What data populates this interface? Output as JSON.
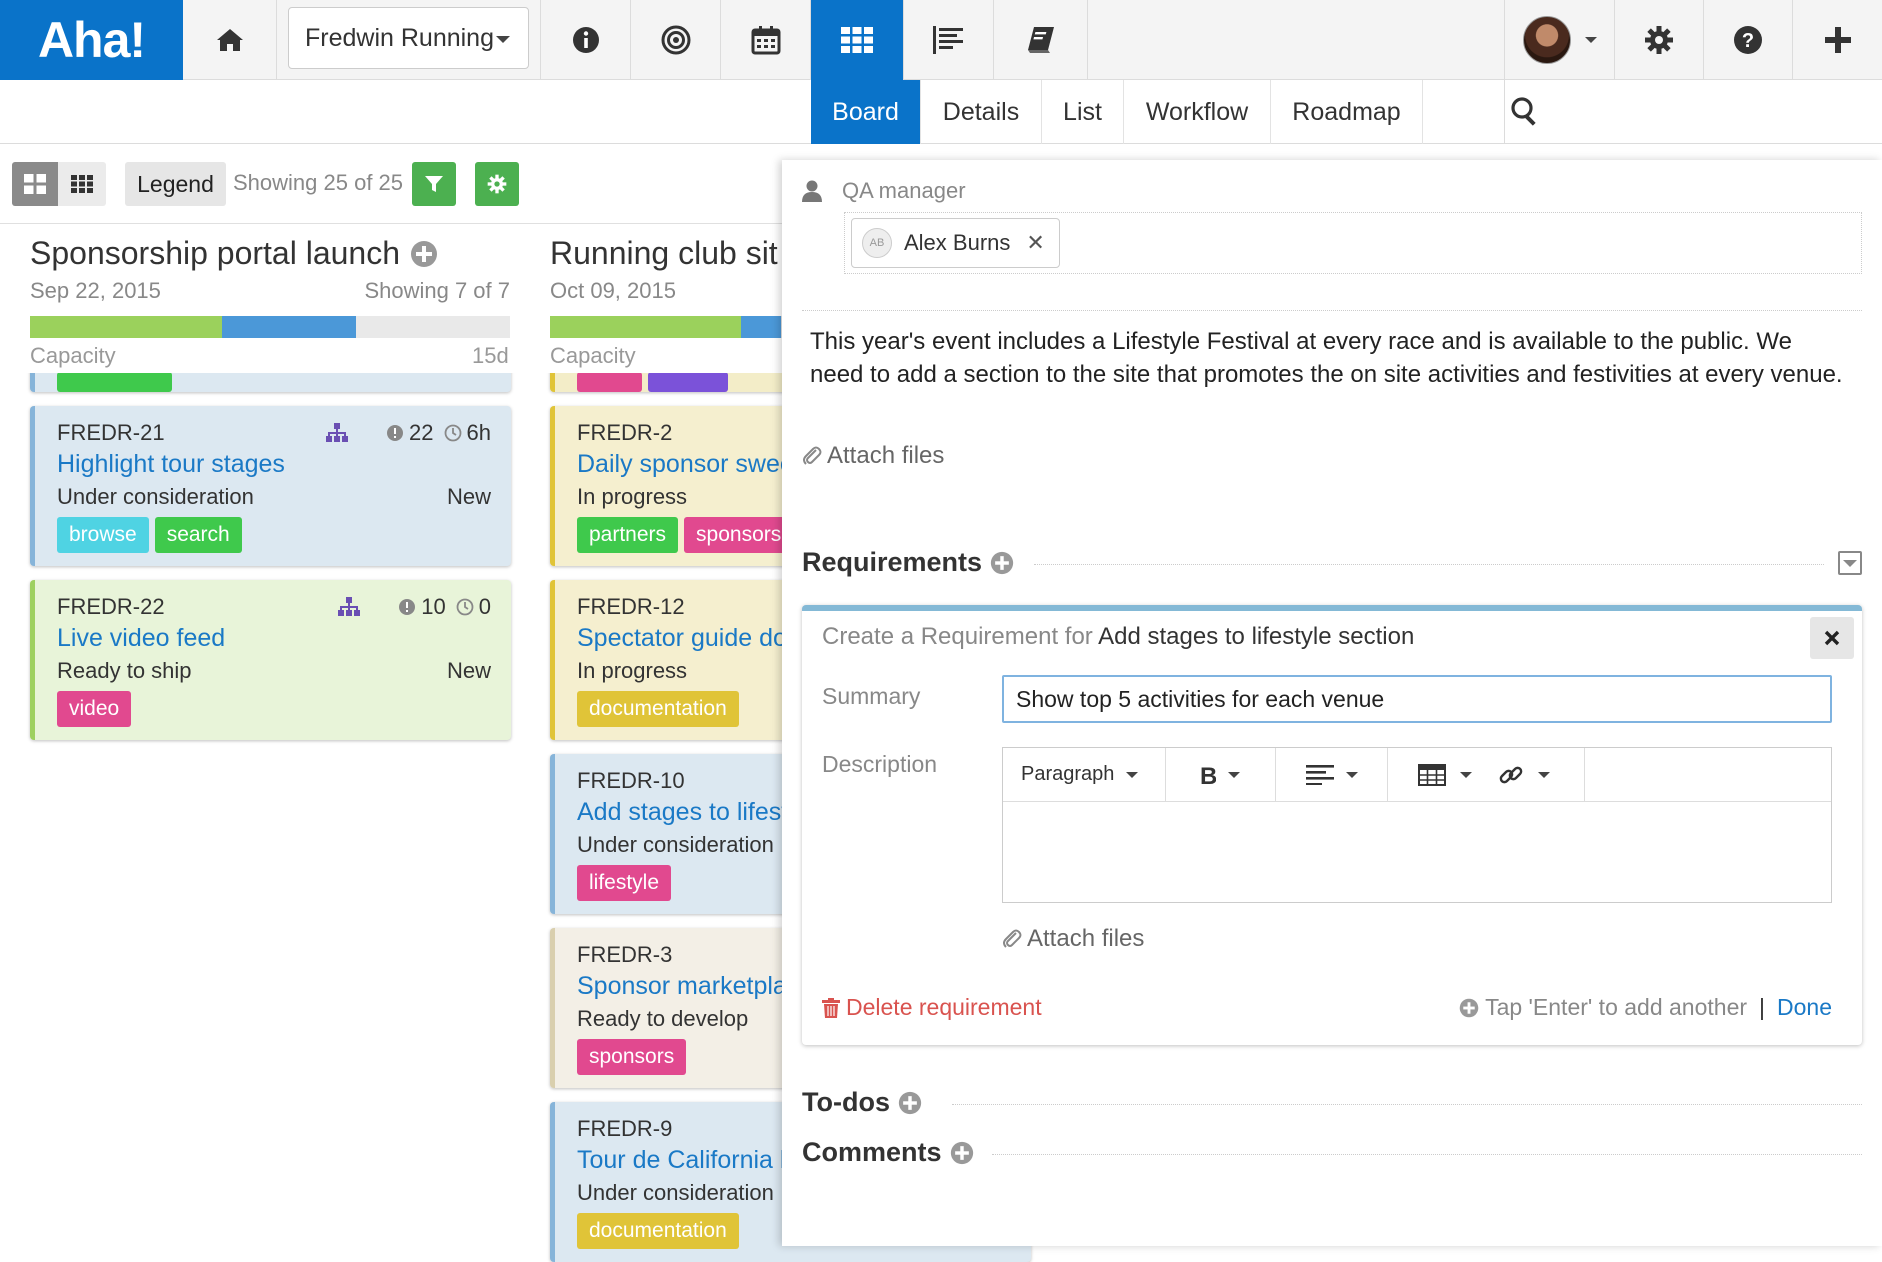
{
  "app": {
    "logo": "Aha!",
    "product": "Fredwin Running",
    "colors": {
      "brand": "#0a73c9",
      "accent_green": "#4cb050",
      "link": "#1a79c6",
      "danger": "#d9534f"
    }
  },
  "topnav": {
    "icons": [
      "home-icon",
      "info-icon",
      "target-icon",
      "calendar-icon",
      "grid-icon",
      "list-lines-icon",
      "book-icon",
      "user-avatar",
      "gear-icon",
      "help-icon",
      "plus-icon"
    ]
  },
  "subtabs": [
    {
      "label": "Board",
      "active": true
    },
    {
      "label": "Details",
      "active": false
    },
    {
      "label": "List",
      "active": false
    },
    {
      "label": "Workflow",
      "active": false
    },
    {
      "label": "Roadmap",
      "active": false
    }
  ],
  "toolbar": {
    "legend_label": "Legend",
    "showing_text": "Showing 25 of 25"
  },
  "columns": [
    {
      "title": "Sponsorship portal launch",
      "date": "Sep 22, 2015",
      "showing": "Showing 7 of 7",
      "capacity_label": "Capacity",
      "capacity_value": "15d",
      "capacity": {
        "green_fraction": 0.4,
        "blue_fraction": 0.28
      },
      "cards": [
        {
          "id": "FREDR-21",
          "title": "Highlight tour stages",
          "status": "Under consideration",
          "badge": "New",
          "count": "22",
          "time": "6h",
          "tags": [
            "browse",
            "search"
          ]
        },
        {
          "id": "FREDR-22",
          "title": "Live video feed",
          "status": "Ready to ship",
          "badge": "New",
          "count": "10",
          "time": "0",
          "tags": [
            "video"
          ]
        }
      ]
    },
    {
      "title": "Running club sit",
      "date": "Oct 09, 2015",
      "capacity_label": "Capacity",
      "capacity": {
        "green_fraction": 0.58,
        "blue_fraction": 0.12
      },
      "cards": [
        {
          "id": "FREDR-2",
          "title": "Daily sponsor swee",
          "status": "In progress",
          "tags": [
            "partners",
            "sponsors"
          ]
        },
        {
          "id": "FREDR-12",
          "title": "Spectator guide do",
          "status": "In progress",
          "tags": [
            "documentation"
          ]
        },
        {
          "id": "FREDR-10",
          "title": "Add stages to lifest",
          "status": "Under consideration",
          "tags": [
            "lifestyle"
          ]
        },
        {
          "id": "FREDR-3",
          "title": "Sponsor marketpla",
          "status": "Ready to develop",
          "tags": [
            "sponsors"
          ]
        },
        {
          "id": "FREDR-9",
          "title": "Tour de California h",
          "status": "Under consideration",
          "tags": [
            "documentation"
          ]
        }
      ]
    }
  ],
  "tag_colors": {
    "browse": "#4fd3e3",
    "search": "#3fc94c",
    "video": "#e1498f",
    "partners": "#3fc94c",
    "sponsors": "#e1498f",
    "documentation": "#e0c438",
    "lifestyle": "#e1498f"
  },
  "detail": {
    "qa_label": "QA manager",
    "qa_user": "Alex Burns",
    "qa_initials": "AB",
    "description": "This year's event includes a Lifestyle Festival at every race and is available to the public. We need to add a section to the site that promotes the on site activities and festivities at every venue.",
    "attach_label": "Attach files",
    "requirements_label": "Requirements",
    "todos_label": "To-dos",
    "comments_label": "Comments"
  },
  "requirement_form": {
    "header_prefix": "Create a Requirement for",
    "header_feature": "Add stages to lifestyle section",
    "summary_label": "Summary",
    "summary_value": "Show top 5 activities for each venue",
    "description_label": "Description",
    "paragraph_label": "Paragraph",
    "attach_label": "Attach files",
    "delete_label": "Delete requirement",
    "add_another_label": "Tap 'Enter' to add another",
    "separator": "|",
    "done_label": "Done"
  }
}
